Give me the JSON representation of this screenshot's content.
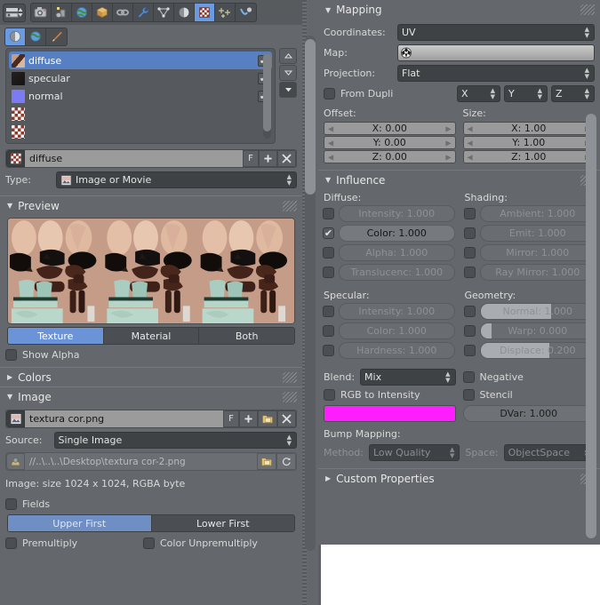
{
  "app": {
    "editor_type": "properties-editor",
    "theme_accent": "#5680c2",
    "panel_bg": "#64676b"
  },
  "property_tabs": [
    {
      "name": "render",
      "icon": "camera-icon",
      "active": false
    },
    {
      "name": "render-layers",
      "icon": "layers-icon",
      "active": false
    },
    {
      "name": "scene-world",
      "icon": "globe-icon",
      "active": false
    },
    {
      "name": "object",
      "icon": "cube-icon",
      "active": false
    },
    {
      "name": "constraints",
      "icon": "chain-icon",
      "active": false
    },
    {
      "name": "modifiers",
      "icon": "wrench-icon",
      "active": false
    },
    {
      "name": "object-data",
      "icon": "triangle-mesh-icon",
      "active": false
    },
    {
      "name": "material",
      "icon": "sphere-icon",
      "active": false
    },
    {
      "name": "texture",
      "icon": "checker-icon",
      "active": true
    },
    {
      "name": "particles",
      "icon": "particles-icon",
      "active": false
    },
    {
      "name": "physics",
      "icon": "physics-icon",
      "active": false
    }
  ],
  "texture_context_tabs": [
    {
      "name": "material-texture",
      "icon": "sphere-icon",
      "active": true
    },
    {
      "name": "world-texture",
      "icon": "globe-icon",
      "active": false
    },
    {
      "name": "brush-texture",
      "icon": "brush-icon",
      "active": false
    }
  ],
  "texture_slots": {
    "items": [
      {
        "label": "diffuse",
        "selected": true,
        "enabled": true,
        "thumb": "image"
      },
      {
        "label": "specular",
        "selected": false,
        "enabled": true,
        "thumb": "dark"
      },
      {
        "label": "normal",
        "selected": false,
        "enabled": true,
        "thumb": "normal"
      },
      {
        "label": "",
        "selected": false,
        "enabled": false,
        "thumb": "checker"
      },
      {
        "label": "",
        "selected": false,
        "enabled": false,
        "thumb": "checker"
      }
    ],
    "buttons": [
      "move-up",
      "move-down",
      "specials-menu"
    ]
  },
  "datablock": {
    "name": "diffuse",
    "fake_user_label": "F",
    "new_label": "+",
    "unlink_label": "✕"
  },
  "type_row": {
    "label": "Type:",
    "value": "Image or Movie"
  },
  "preview": {
    "header": "Preview",
    "modes": [
      {
        "label": "Texture",
        "active": true
      },
      {
        "label": "Material",
        "active": false
      },
      {
        "label": "Both",
        "active": false
      }
    ],
    "show_alpha": {
      "label": "Show Alpha",
      "checked": false
    }
  },
  "colors_section": {
    "header": "Colors",
    "expanded": false
  },
  "image_section": {
    "header": "Image",
    "expanded": true,
    "image_name": "textura cor.png",
    "fake_user_label": "F",
    "new_label": "+",
    "open_label": "open-folder",
    "unlink_label": "✕",
    "source_label": "Source:",
    "source_value": "Single Image",
    "filepath": "//..\\..\\..\\Desktop\\textura cor-2.png",
    "info": "Image: size 1024 x 1024, RGBA byte",
    "fields": {
      "label": "Fields",
      "checked": false
    },
    "field_order": [
      {
        "label": "Upper First",
        "active": true
      },
      {
        "label": "Lower First",
        "active": false
      }
    ],
    "premultiply": {
      "label": "Premultiply",
      "checked": false
    },
    "color_unpremultiply": {
      "label": "Color Unpremultiply",
      "checked": false
    }
  },
  "mapping": {
    "header": "Mapping",
    "expanded": true,
    "coordinates_label": "Coordinates:",
    "coordinates_value": "UV",
    "map_label": "Map:",
    "map_value": "",
    "projection_label": "Projection:",
    "projection_value": "Flat",
    "from_dupli": {
      "label": "From Dupli",
      "checked": false
    },
    "axis_selectors": [
      "X",
      "Y",
      "Z"
    ],
    "offset_label": "Offset:",
    "offset": [
      "X: 0.00",
      "Y: 0.00",
      "Z: 0.00"
    ],
    "size_label": "Size:",
    "size": [
      "X: 1.00",
      "Y: 1.00",
      "Z: 1.00"
    ]
  },
  "influence": {
    "header": "Influence",
    "expanded": true,
    "groups": [
      {
        "name": "Diffuse:",
        "rows": [
          {
            "label": "Intensity: 1.000",
            "checked": false,
            "fill": 0
          },
          {
            "label": "Color: 1.000",
            "checked": true,
            "fill": 0
          },
          {
            "label": "Alpha: 1.000",
            "checked": false,
            "fill": 0
          },
          {
            "label": "Translucenc: 1.000",
            "checked": false,
            "fill": 0
          }
        ]
      },
      {
        "name": "Shading:",
        "rows": [
          {
            "label": "Ambient: 1.000",
            "checked": false,
            "fill": 0
          },
          {
            "label": "Emit: 1.000",
            "checked": false,
            "fill": 0
          },
          {
            "label": "Mirror: 1.000",
            "checked": false,
            "fill": 0
          },
          {
            "label": "Ray Mirror: 1.000",
            "checked": false,
            "fill": 0
          }
        ]
      },
      {
        "name": "Specular:",
        "rows": [
          {
            "label": "Intensity: 1.000",
            "checked": false,
            "fill": 0
          },
          {
            "label": "Color: 1.000",
            "checked": false,
            "fill": 0
          },
          {
            "label": "Hardness: 1.000",
            "checked": false,
            "fill": 0
          }
        ]
      },
      {
        "name": "Geometry:",
        "rows": [
          {
            "label": "Normal: 1.000",
            "checked": false,
            "fill": 62
          },
          {
            "label": "Warp: 0.000",
            "checked": false,
            "fill": 10
          },
          {
            "label": "Displace: 0.200",
            "checked": false,
            "fill": 60
          }
        ]
      }
    ],
    "blend_label": "Blend:",
    "blend_value": "Mix",
    "negative": {
      "label": "Negative",
      "checked": false
    },
    "rgb_to_intensity": {
      "label": "RGB to Intensity",
      "checked": false
    },
    "stencil": {
      "label": "Stencil",
      "checked": false
    },
    "color_swatch": "#FF1EFF",
    "dvar_label": "DVar: 1.000",
    "bump_mapping_label": "Bump Mapping:",
    "method_label": "Method:",
    "method_value": "Low Quality",
    "space_label": "Space:",
    "space_value": "ObjectSpace"
  },
  "custom_properties": {
    "header": "Custom Properties",
    "expanded": false
  }
}
